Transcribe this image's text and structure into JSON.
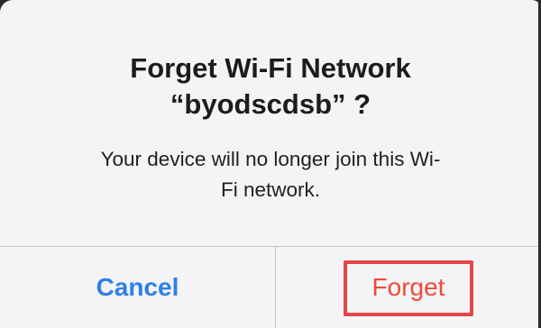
{
  "dialog": {
    "title_line1": "Forget Wi-Fi Network",
    "title_line2": "“byodscdsb” ?",
    "message_line1": "Your device will no longer join this Wi-",
    "message_line2": "Fi network."
  },
  "buttons": {
    "cancel_label": "Cancel",
    "forget_label": "Forget"
  },
  "colors": {
    "cancel": "#2f7fe8",
    "forget": "#f0493a",
    "highlight": "#e34646",
    "background": "#f4f4f6"
  }
}
